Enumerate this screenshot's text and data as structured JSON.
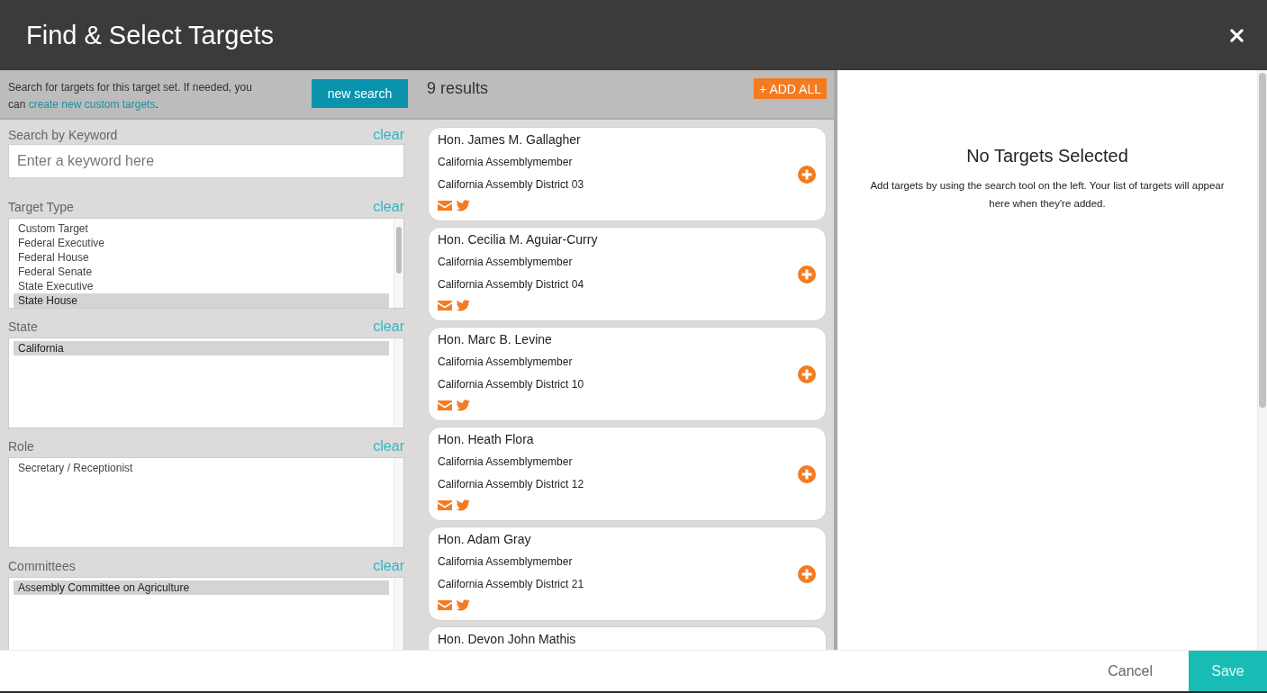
{
  "dialog": {
    "title": "Find & Select Targets"
  },
  "search": {
    "intro": {
      "text": "Search for targets for this target set. If needed, you can ",
      "link": "create new custom targets",
      "end": "."
    },
    "new_search": "new search",
    "filters": [
      {
        "kind": "text",
        "label": "Search by Keyword",
        "clear": "clear",
        "placeholder": "Enter a keyword here"
      },
      {
        "kind": "list",
        "label": "Target Type",
        "clear": "clear",
        "options": [
          {
            "label": "Custom Target",
            "selected": false
          },
          {
            "label": "Federal Executive",
            "selected": false
          },
          {
            "label": "Federal House",
            "selected": false
          },
          {
            "label": "Federal Senate",
            "selected": false
          },
          {
            "label": "State Executive",
            "selected": false
          },
          {
            "label": "State House",
            "selected": true
          }
        ]
      },
      {
        "kind": "list",
        "label": "State",
        "clear": "clear",
        "options": [
          {
            "label": "California",
            "selected": true
          }
        ]
      },
      {
        "kind": "list",
        "label": "Role",
        "clear": "clear",
        "options": [
          {
            "label": "Secretary / Receptionist",
            "selected": false
          }
        ]
      },
      {
        "kind": "list",
        "label": "Committees",
        "clear": "clear",
        "options": [
          {
            "label": "Assembly Committee on Agriculture",
            "selected": true
          }
        ]
      }
    ]
  },
  "results": {
    "count": "9 results",
    "add_all": "+ ADD ALL",
    "cards": [
      {
        "name": "Hon. James M. Gallagher",
        "role": "California Assemblymember",
        "district": "California Assembly District 03"
      },
      {
        "name": "Hon. Cecilia M. Aguiar-Curry",
        "role": "California Assemblymember",
        "district": "California Assembly District 04"
      },
      {
        "name": "Hon. Marc B. Levine",
        "role": "California Assemblymember",
        "district": "California Assembly District 10"
      },
      {
        "name": "Hon. Heath Flora",
        "role": "California Assemblymember",
        "district": "California Assembly District 12"
      },
      {
        "name": "Hon. Adam Gray",
        "role": "California Assemblymember",
        "district": "California Assembly District 21"
      },
      {
        "name": "Hon. Devon John Mathis"
      }
    ]
  },
  "selection": {
    "title": "No Targets Selected",
    "hint": "Add targets by using the search tool on the left. Your list of targets will appear here when they're added."
  },
  "footer": {
    "cancel": "Cancel",
    "save": "Save"
  }
}
